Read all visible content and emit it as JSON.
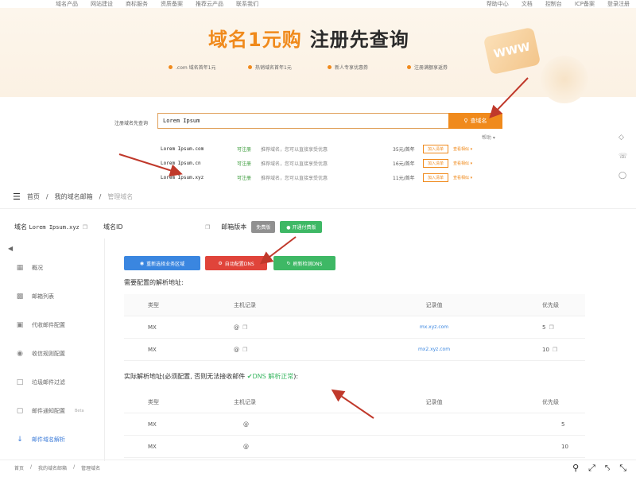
{
  "topnav": {
    "left": [
      "域名产品",
      "网站建设",
      "商标服务",
      "资质备案",
      "推荐云产品",
      "联系我们"
    ],
    "right": [
      "帮助中心",
      "文档",
      "控制台",
      "ICP备案",
      "登录注册"
    ]
  },
  "banner": {
    "title_orange": "域名1元购",
    "title_dark": "注册先查询",
    "deco": "WWW",
    "promos": [
      ".com 域名首年1元",
      "热销域名首年1元",
      "新人专享优惠券",
      "注册满额享返券"
    ]
  },
  "search": {
    "label": "注册域名先查询",
    "value": "Lorem Ipsum",
    "button": "查域名",
    "help": "帮助",
    "results": [
      {
        "name": "Lorem Ipsum.com",
        "status": "可注册",
        "desc": "推荐域名，您可以直接享受优惠",
        "price": "35元/首年",
        "add": "加入清单",
        "more": "查看相似"
      },
      {
        "name": "Lorem Ipsum.cn",
        "status": "可注册",
        "desc": "推荐域名，您可以直接享受优惠",
        "price": "16元/首年",
        "add": "加入清单",
        "more": "查看相似"
      },
      {
        "name": "Lorem Ipsum.xyz",
        "status": "可注册",
        "desc": "推荐域名，您可以直接享受优惠",
        "price": "11元/首年",
        "add": "加入清单",
        "more": "查看相似"
      }
    ]
  },
  "breadcrumb": {
    "home": "首页",
    "mail": "我的域名邮箱",
    "current": "管理域名"
  },
  "domain": {
    "label": "域名",
    "value": "Lorem Ipsum.xyz",
    "id_label": "域名ID",
    "version_label": "邮箱版本",
    "free": "免费版",
    "pay": "开通付费版"
  },
  "sidebar": {
    "items": [
      {
        "label": "概况",
        "icon": "grid"
      },
      {
        "label": "邮箱列表",
        "icon": "chart"
      },
      {
        "label": "代收邮件配置",
        "icon": "inbox"
      },
      {
        "label": "收信规则配置",
        "icon": "pin"
      },
      {
        "label": "垃圾邮件过滤",
        "icon": "filter"
      },
      {
        "label": "邮件通知配置",
        "icon": "bell",
        "beta": "Beta"
      },
      {
        "label": "邮件域名解析",
        "icon": "download"
      }
    ]
  },
  "actions": {
    "reselect": "重新选择业务区域",
    "auto_dns": "自动配置DNS",
    "refresh_dns": "刷新检测DNS"
  },
  "required": {
    "title": "需要配置的解析地址:",
    "headers": [
      "类型",
      "主机记录",
      "记录值",
      "优先级"
    ],
    "rows": [
      {
        "type": "MX",
        "host": "@",
        "value": "mx.xyz.com",
        "priority": "5"
      },
      {
        "type": "MX",
        "host": "@",
        "value": "mx2.xyz.com",
        "priority": "10"
      }
    ]
  },
  "actual": {
    "title": "实际解析地址(必须配置, 否则无法接收邮件",
    "ok": "DNS 解析正常",
    "tail": "):",
    "headers": [
      "类型",
      "主机记录",
      "记录值",
      "优先级"
    ],
    "rows": [
      {
        "type": "MX",
        "host": "@",
        "value": "",
        "priority": "5"
      },
      {
        "type": "MX",
        "host": "@",
        "value": "",
        "priority": "10"
      }
    ]
  },
  "bottom": {
    "home": "首页",
    "mail": "我的域名邮箱",
    "current": "管理域名"
  },
  "colors": {
    "accent": "#f08a1c",
    "blue": "#3a86e0",
    "red": "#e0443a",
    "green": "#3eb865",
    "arrow": "#c0392b"
  }
}
